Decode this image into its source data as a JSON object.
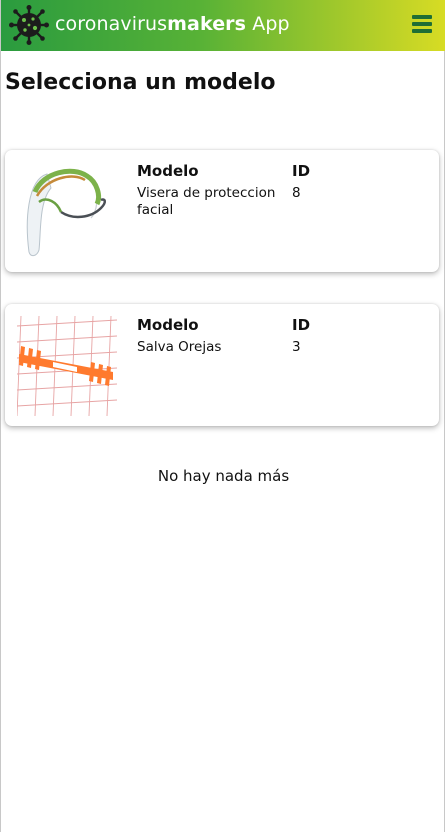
{
  "appbar": {
    "brand_light": "coronavirus",
    "brand_bold": "makers",
    "brand_suffix": " App",
    "logo_icon": "virus-logo-icon",
    "menu_icon": "hamburger-menu-icon",
    "colors": {
      "gradient_start": "#2a9b3f",
      "gradient_end": "#d8dc24",
      "menu": "#1f6e35"
    }
  },
  "page": {
    "title": "Selecciona un modelo"
  },
  "cards": [
    {
      "model_header": "Modelo",
      "model_value": "Visera de proteccion facial",
      "id_header": "ID",
      "id_value": "8",
      "thumb_icon": "face-shield-image"
    },
    {
      "model_header": "Modelo",
      "model_value": "Salva Orejas",
      "id_header": "ID",
      "id_value": "3",
      "thumb_icon": "ear-saver-image"
    }
  ],
  "footer": {
    "text": "No hay nada más"
  }
}
